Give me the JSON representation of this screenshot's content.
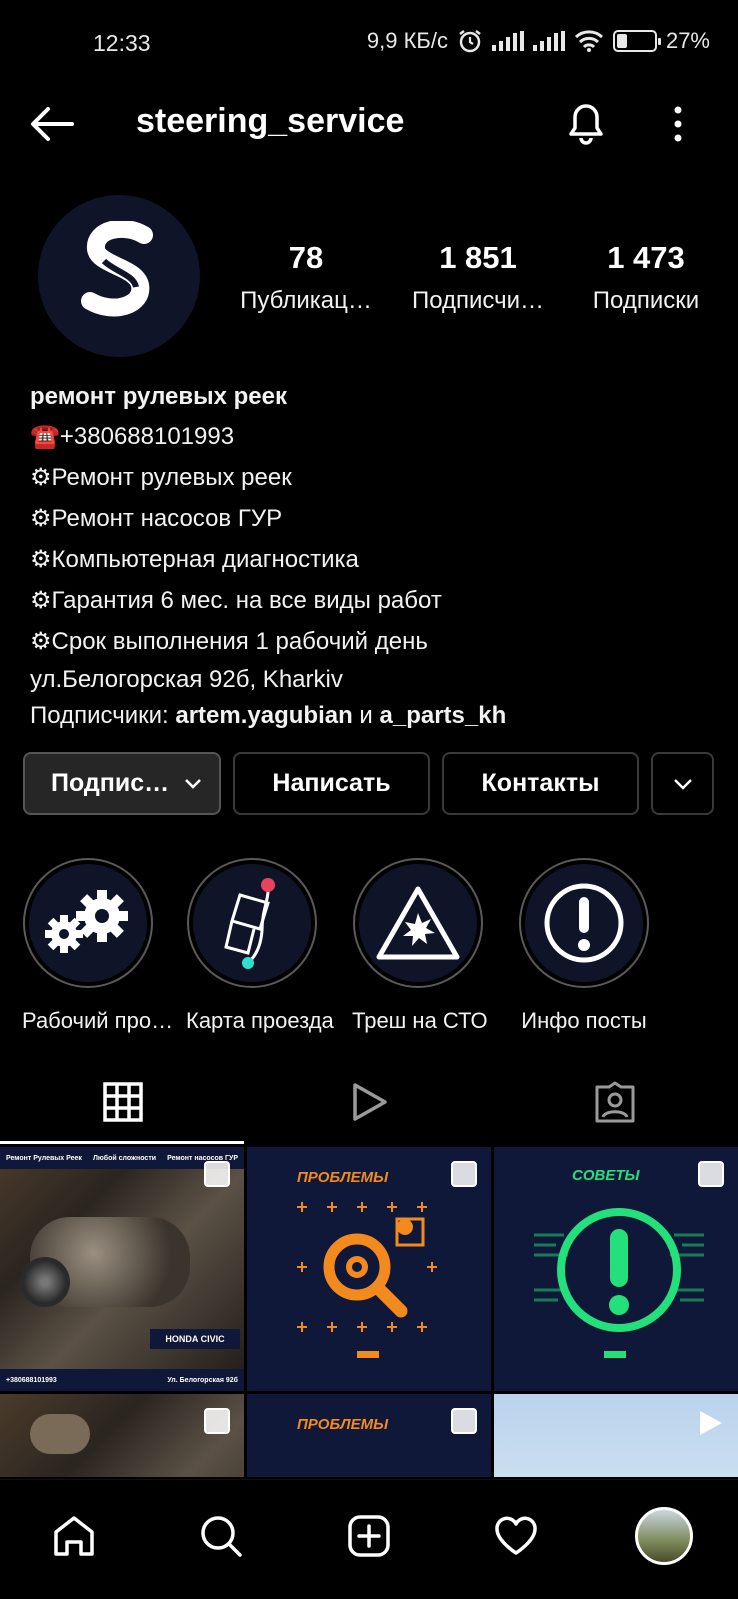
{
  "status_bar": {
    "time": "12:33",
    "speed": "9,9 КБ/с",
    "battery_text": "27%",
    "battery_level": 0.27
  },
  "header": {
    "username": "steering_service",
    "icons": [
      "back-arrow-icon",
      "bell-icon",
      "more-vertical-icon"
    ]
  },
  "profile": {
    "stats": [
      {
        "value": "78",
        "label": "Публикац…"
      },
      {
        "value": "1 851",
        "label": "Подписчи…"
      },
      {
        "value": "1 473",
        "label": "Подписки"
      }
    ],
    "bio": {
      "name": "ремонт рулевых реек",
      "lines": [
        "☎️+380688101993",
        "⚙Ремонт рулевых реек",
        "⚙Ремонт насосов ГУР",
        "⚙Компьютерная диагностика",
        "⚙Гарантия 6 мес. на все виды работ",
        "⚙Срок выполнения 1 рабочий день"
      ],
      "location": "ул.Белогорская 92б, Kharkiv",
      "followers_prefix": "Подписчики: ",
      "follower_1": "artem.yagubian",
      "followers_and": " и ",
      "follower_2": "a_parts_kh"
    }
  },
  "actions": {
    "subscribed": "Подпис…",
    "message": "Написать",
    "contacts": "Контакты"
  },
  "highlights": [
    {
      "label": "Рабочий про…",
      "icon": "gears-icon"
    },
    {
      "label": "Карта проезда",
      "icon": "map-route-icon"
    },
    {
      "label": "Треш на СТО",
      "icon": "explosion-warning-icon"
    },
    {
      "label": "Инфо посты",
      "icon": "exclamation-icon"
    }
  ],
  "posts": [
    {
      "header_texts": [
        "Ремонт Рулевых Реек",
        "Любой сложности",
        "Ремонт насосов ГУР"
      ],
      "caption": "HONDA CIVIC",
      "footer": [
        "+380688101993",
        "Ул. Белогорская 92б"
      ]
    },
    {
      "title": "ПРОБЛЕМЫ"
    },
    {
      "title": "СОВЕТЫ"
    },
    {},
    {
      "title": "ПРОБЛЕМЫ"
    },
    {}
  ],
  "colors": {
    "background": "#000000",
    "navy": "#0f1838",
    "orange": "#f28a1e",
    "green": "#23e07a"
  }
}
